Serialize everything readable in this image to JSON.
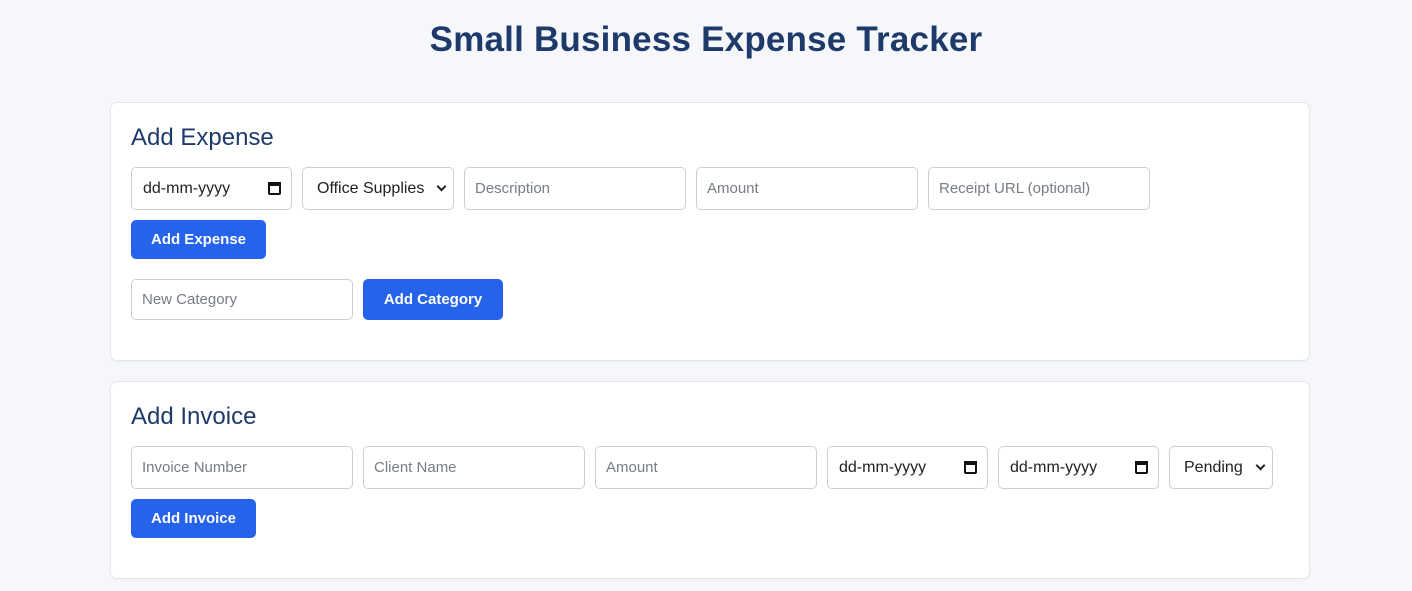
{
  "page": {
    "title": "Small Business Expense Tracker"
  },
  "expense": {
    "heading": "Add Expense",
    "date_placeholder": "dd-mm-yyyy",
    "category_selected": "Office Supplies",
    "description_placeholder": "Description",
    "amount_placeholder": "Amount",
    "receipt_placeholder": "Receipt URL (optional)",
    "add_button": "Add Expense",
    "new_category_placeholder": "New Category",
    "add_category_button": "Add Category"
  },
  "invoice": {
    "heading": "Add Invoice",
    "number_placeholder": "Invoice Number",
    "client_placeholder": "Client Name",
    "amount_placeholder": "Amount",
    "date1_placeholder": "dd-mm-yyyy",
    "date2_placeholder": "dd-mm-yyyy",
    "status_selected": "Pending",
    "add_button": "Add Invoice"
  },
  "colors": {
    "accent": "#2563eb",
    "heading": "#1e3a6a"
  },
  "icons": {
    "date": "calendar-icon",
    "select": "chevron-down-icon"
  }
}
